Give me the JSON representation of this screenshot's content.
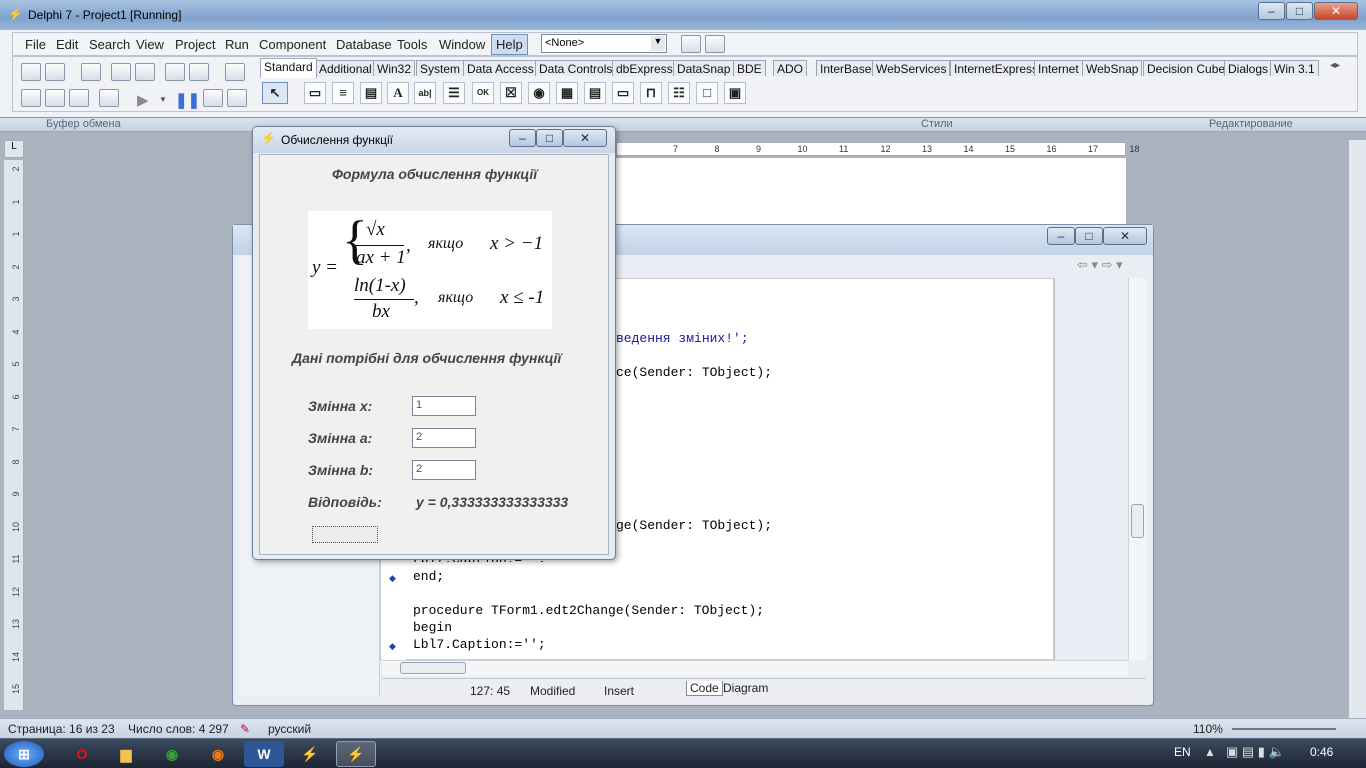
{
  "delphi": {
    "title": "Delphi 7 - Project1 [Running]",
    "menu": [
      "File",
      "Edit",
      "Search",
      "View",
      "Project",
      "Run",
      "Component",
      "Database",
      "Tools",
      "Window",
      "Help"
    ],
    "combo_value": "<None>",
    "palette_tabs": [
      "Standard",
      "Additional",
      "Win32",
      "System",
      "Data Access",
      "Data Controls",
      "dbExpress",
      "DataSnap",
      "BDE",
      "ADO",
      "InterBase",
      "WebServices",
      "InternetExpress",
      "Internet",
      "WebSnap",
      "Decision Cube",
      "Dialogs",
      "Win 3.1"
    ]
  },
  "word": {
    "groups": [
      "Буфер обмена",
      "Стили",
      "Редактирование"
    ],
    "ruler_h": [
      "7",
      "8",
      "9",
      "10",
      "11",
      "12",
      "13",
      "14",
      "15",
      "16",
      "17",
      "18"
    ],
    "ruler_v": [
      "2",
      "1",
      "1",
      "2",
      "3",
      "4",
      "5",
      "6",
      "7",
      "8",
      "9",
      "10",
      "11",
      "12",
      "13",
      "14",
      "15"
    ],
    "status": {
      "page": "Страница: 16 из 23",
      "words": "Число слов: 4 297",
      "lang": "русский",
      "zoom": "110%"
    }
  },
  "editor": {
    "code_lines": [
      "ведення зміних!';",
      "ce(Sender: TObject);",
      "ge(Sender: TObject);",
      "Lbl7.Caption:='';",
      "end;",
      "procedure TForm1.edt2Change(Sender: TObject);",
      "begin",
      "Lbl7.Caption:='';"
    ],
    "status": {
      "pos": "127:  45",
      "state": "Modified",
      "mode": "Insert"
    },
    "tabs": [
      "Code",
      "Diagram"
    ]
  },
  "form": {
    "title": "Обчислення функції",
    "heading": "Формула обчислення функції",
    "formula": {
      "lhs": "y =",
      "num1": "√x",
      "den1": "ax + 1",
      "cond1": "якщо",
      "rel1": "x > −1",
      "num2": "ln(1-x)",
      "den2": "bx",
      "cond2": "якщо",
      "rel2": "x ≤ -1"
    },
    "subheading": "Дані потрібні для обчислення функції",
    "fields": [
      {
        "label": "Змінна x:",
        "value": "1"
      },
      {
        "label": "Змінна a:",
        "value": "2"
      },
      {
        "label": "Змінна b:",
        "value": "2"
      }
    ],
    "answer_label": "Відповідь:",
    "answer_value": "y = 0,333333333333333"
  },
  "taskbar": {
    "lang": "EN",
    "time": "0:46"
  }
}
